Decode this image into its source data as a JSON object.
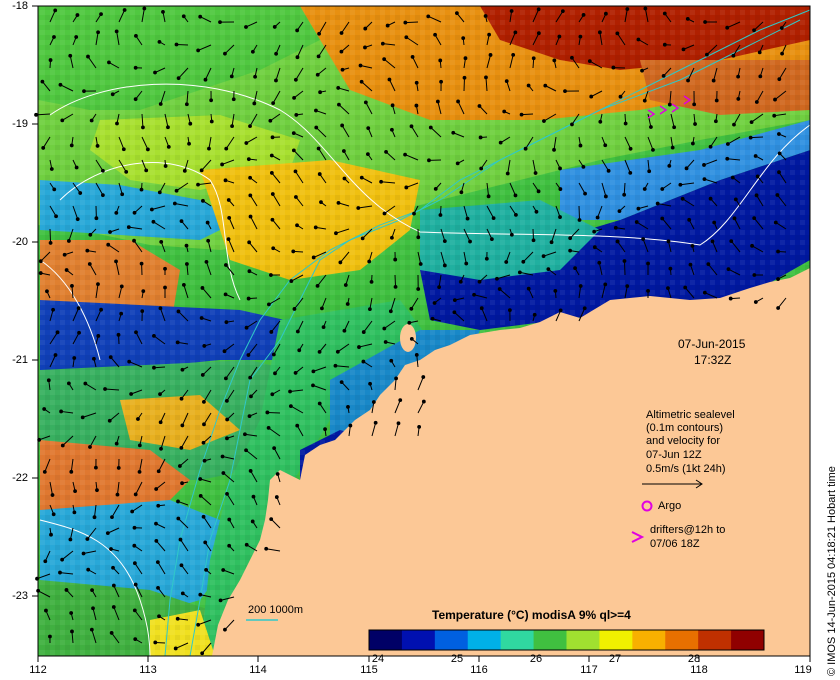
{
  "map": {
    "title_date": "07-Jun-2015",
    "title_time": "17:32Z",
    "lon_ticks": [
      "112",
      "113",
      "114",
      "115",
      "116",
      "117",
      "118",
      "119"
    ],
    "lat_ticks": [
      "-18",
      "-19",
      "-20",
      "-21",
      "-22",
      "-23"
    ],
    "extent": {
      "lon": [
        112,
        119
      ],
      "lat": [
        -23.5,
        -18
      ]
    },
    "land_color": "#fcc896"
  },
  "legend": {
    "sealevel_lines": [
      "Altimetric sealevel",
      "(0.1m contours)",
      "and velocity for",
      "07-Jun 12Z",
      "0.5m/s (1kt 24h)"
    ],
    "argo_label": "Argo",
    "drifters_line1": "drifters@12h to",
    "drifters_line2": "07/06 18Z",
    "argo_color": "#e000e0",
    "drifter_color": "#e000e0",
    "bathymetry_label": "200  1000m",
    "bathymetry_color": "#30c8c8"
  },
  "colorbar": {
    "title": "Temperature (°C) modisA 9% ql>=4",
    "ticks": [
      "24",
      "25",
      "26",
      "27",
      "28"
    ],
    "range": [
      23.5,
      28.5
    ],
    "colors": [
      "#000066",
      "#0010b0",
      "#0060e0",
      "#00b0e8",
      "#30d8a0",
      "#40c040",
      "#a0e030",
      "#f0f000",
      "#f8b000",
      "#e87000",
      "#c03000",
      "#900000"
    ]
  },
  "credit": "© IMOS 14-Jun-2015 04:18:21 Hobart time"
}
